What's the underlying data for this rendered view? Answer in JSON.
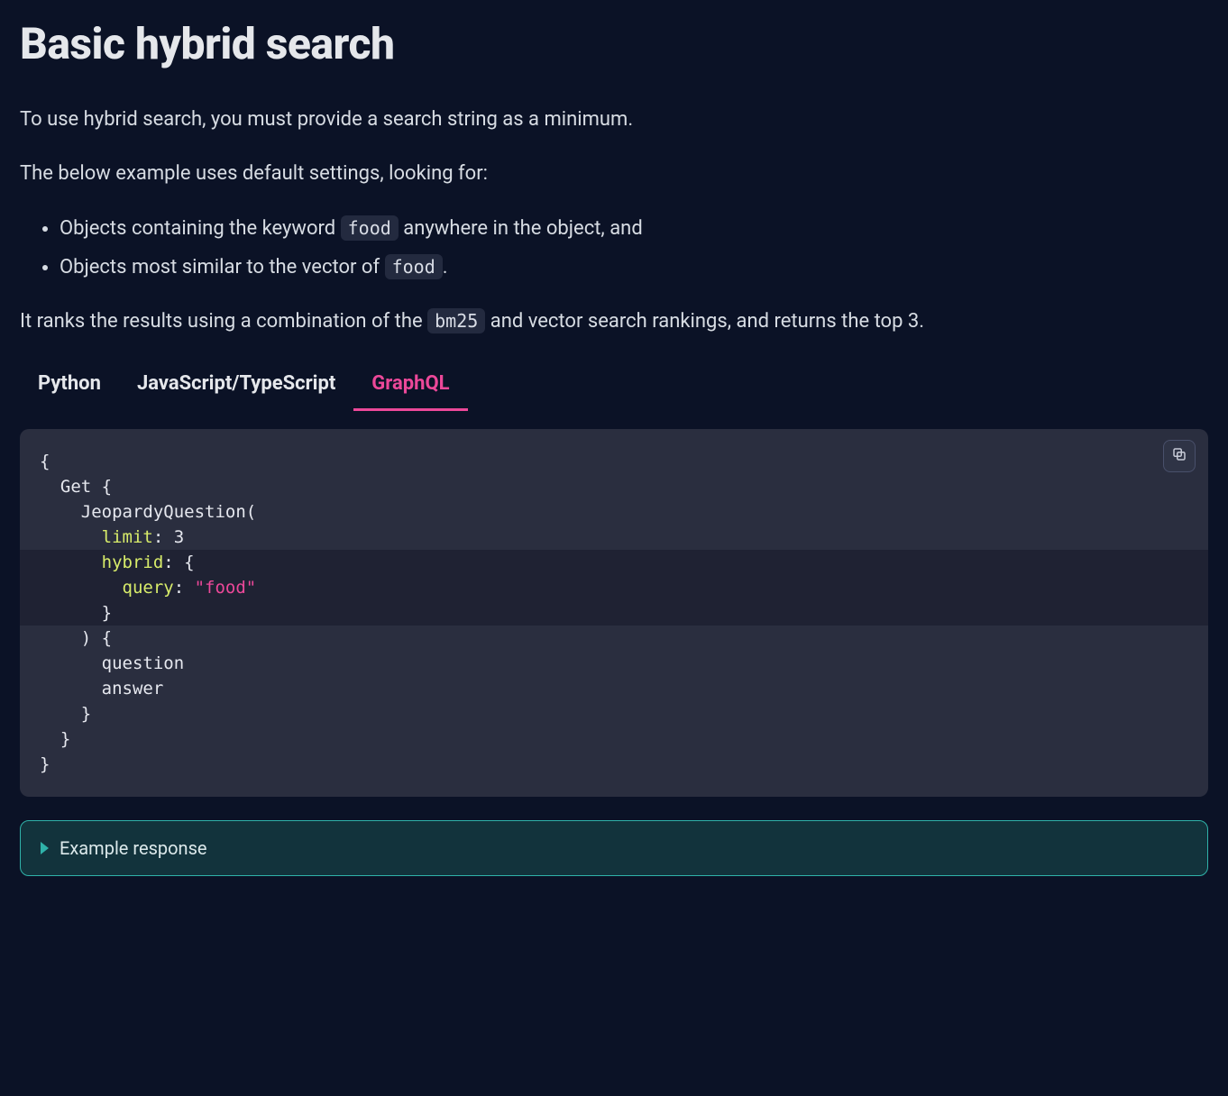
{
  "heading": "Basic hybrid search",
  "intro1": "To use hybrid search, you must provide a search string as a minimum.",
  "intro2": "The below example uses default settings, looking for:",
  "bullets": {
    "b1a": "Objects containing the keyword ",
    "b1code": "food",
    "b1b": " anywhere in the object, and",
    "b2a": "Objects most similar to the vector of ",
    "b2code": "food",
    "b2b": "."
  },
  "ranking": {
    "a": "It ranks the results using a combination of the ",
    "code": "bm25",
    "b": " and vector search rankings, and returns the top 3."
  },
  "tabs": {
    "python": "Python",
    "js": "JavaScript/TypeScript",
    "graphql": "GraphQL",
    "active": "graphql"
  },
  "code": {
    "l1": "{",
    "l2_pre": "  Get {",
    "l3_pre": "    JeopardyQuestion(",
    "l4_indent": "      ",
    "l4_key": "limit",
    "l4_after": ": 3",
    "l5_indent": "      ",
    "l5_key": "hybrid",
    "l5_after": ": {",
    "l6_indent": "        ",
    "l6_key": "query",
    "l6_colon": ": ",
    "l6_str": "\"food\"",
    "l7": "      }",
    "l8": "    ) {",
    "l9": "      question",
    "l10": "      answer",
    "l11": "    }",
    "l12": "  }",
    "l13": "}"
  },
  "example_response_label": "Example response"
}
